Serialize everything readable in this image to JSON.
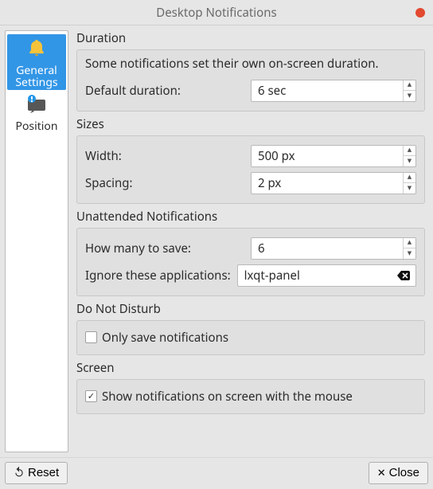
{
  "window": {
    "title": "Desktop Notifications"
  },
  "sidebar": {
    "items": [
      {
        "label": "General Settings",
        "selected": true
      },
      {
        "label": "Position",
        "selected": false
      }
    ]
  },
  "sections": {
    "duration": {
      "title": "Duration",
      "description": "Some notifications set their own on-screen duration.",
      "default_duration_label": "Default duration:",
      "default_duration_value": "6 sec"
    },
    "sizes": {
      "title": "Sizes",
      "width_label": "Width:",
      "width_value": "500 px",
      "spacing_label": "Spacing:",
      "spacing_value": "2 px"
    },
    "unattended": {
      "title": "Unattended Notifications",
      "how_many_label": "How many to save:",
      "how_many_value": "6",
      "ignore_label": "Ignore these applications:",
      "ignore_value": "lxqt-panel"
    },
    "dnd": {
      "title": "Do Not Disturb",
      "only_save_label": "Only save notifications",
      "only_save_checked": false
    },
    "screen": {
      "title": "Screen",
      "show_on_mouse_label": "Show notifications on screen with the mouse",
      "show_on_mouse_checked": true
    }
  },
  "buttons": {
    "reset": "Reset",
    "close": "Close"
  }
}
